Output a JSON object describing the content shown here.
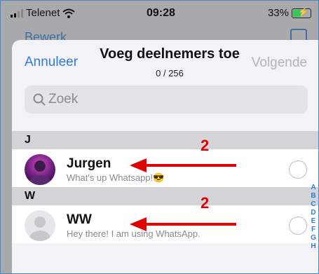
{
  "status_bar": {
    "carrier": "Telenet",
    "time": "09:28",
    "battery": "33%"
  },
  "background_nav": {
    "back_label": "Bewerk"
  },
  "sheet": {
    "cancel": "Annuleer",
    "title": "Voeg deelnemers toe",
    "subtitle": "0 / 256",
    "next": "Volgende",
    "search_placeholder": "Zoek"
  },
  "sections": [
    {
      "letter": "J",
      "contact": {
        "name": "Jurgen",
        "about": "What's up Whatsapp!😎"
      }
    },
    {
      "letter": "W",
      "contact": {
        "name": "WW",
        "about": "Hey there! I am using WhatsApp."
      }
    }
  ],
  "index_letters": [
    "A",
    "B",
    "C",
    "D",
    "E",
    "F",
    "G",
    "H"
  ],
  "annotations": [
    "2",
    "2"
  ],
  "colors": {
    "accent": "#2f7bd6",
    "annotation": "#e00000",
    "battery": "#35c759"
  }
}
